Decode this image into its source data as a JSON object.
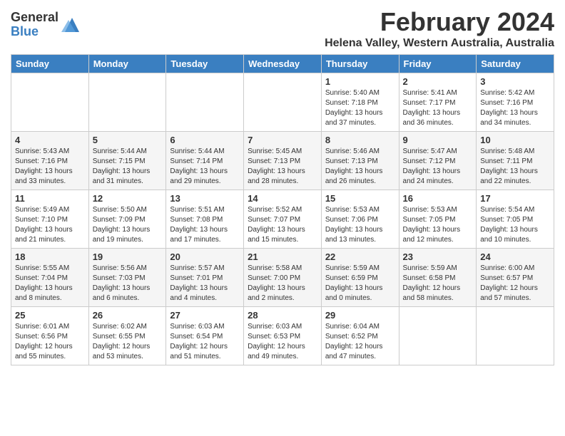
{
  "logo": {
    "general": "General",
    "blue": "Blue"
  },
  "title": "February 2024",
  "location": "Helena Valley, Western Australia, Australia",
  "headers": [
    "Sunday",
    "Monday",
    "Tuesday",
    "Wednesday",
    "Thursday",
    "Friday",
    "Saturday"
  ],
  "weeks": [
    [
      {
        "day": "",
        "info": ""
      },
      {
        "day": "",
        "info": ""
      },
      {
        "day": "",
        "info": ""
      },
      {
        "day": "",
        "info": ""
      },
      {
        "day": "1",
        "info": "Sunrise: 5:40 AM\nSunset: 7:18 PM\nDaylight: 13 hours\nand 37 minutes."
      },
      {
        "day": "2",
        "info": "Sunrise: 5:41 AM\nSunset: 7:17 PM\nDaylight: 13 hours\nand 36 minutes."
      },
      {
        "day": "3",
        "info": "Sunrise: 5:42 AM\nSunset: 7:16 PM\nDaylight: 13 hours\nand 34 minutes."
      }
    ],
    [
      {
        "day": "4",
        "info": "Sunrise: 5:43 AM\nSunset: 7:16 PM\nDaylight: 13 hours\nand 33 minutes."
      },
      {
        "day": "5",
        "info": "Sunrise: 5:44 AM\nSunset: 7:15 PM\nDaylight: 13 hours\nand 31 minutes."
      },
      {
        "day": "6",
        "info": "Sunrise: 5:44 AM\nSunset: 7:14 PM\nDaylight: 13 hours\nand 29 minutes."
      },
      {
        "day": "7",
        "info": "Sunrise: 5:45 AM\nSunset: 7:13 PM\nDaylight: 13 hours\nand 28 minutes."
      },
      {
        "day": "8",
        "info": "Sunrise: 5:46 AM\nSunset: 7:13 PM\nDaylight: 13 hours\nand 26 minutes."
      },
      {
        "day": "9",
        "info": "Sunrise: 5:47 AM\nSunset: 7:12 PM\nDaylight: 13 hours\nand 24 minutes."
      },
      {
        "day": "10",
        "info": "Sunrise: 5:48 AM\nSunset: 7:11 PM\nDaylight: 13 hours\nand 22 minutes."
      }
    ],
    [
      {
        "day": "11",
        "info": "Sunrise: 5:49 AM\nSunset: 7:10 PM\nDaylight: 13 hours\nand 21 minutes."
      },
      {
        "day": "12",
        "info": "Sunrise: 5:50 AM\nSunset: 7:09 PM\nDaylight: 13 hours\nand 19 minutes."
      },
      {
        "day": "13",
        "info": "Sunrise: 5:51 AM\nSunset: 7:08 PM\nDaylight: 13 hours\nand 17 minutes."
      },
      {
        "day": "14",
        "info": "Sunrise: 5:52 AM\nSunset: 7:07 PM\nDaylight: 13 hours\nand 15 minutes."
      },
      {
        "day": "15",
        "info": "Sunrise: 5:53 AM\nSunset: 7:06 PM\nDaylight: 13 hours\nand 13 minutes."
      },
      {
        "day": "16",
        "info": "Sunrise: 5:53 AM\nSunset: 7:05 PM\nDaylight: 13 hours\nand 12 minutes."
      },
      {
        "day": "17",
        "info": "Sunrise: 5:54 AM\nSunset: 7:05 PM\nDaylight: 13 hours\nand 10 minutes."
      }
    ],
    [
      {
        "day": "18",
        "info": "Sunrise: 5:55 AM\nSunset: 7:04 PM\nDaylight: 13 hours\nand 8 minutes."
      },
      {
        "day": "19",
        "info": "Sunrise: 5:56 AM\nSunset: 7:03 PM\nDaylight: 13 hours\nand 6 minutes."
      },
      {
        "day": "20",
        "info": "Sunrise: 5:57 AM\nSunset: 7:01 PM\nDaylight: 13 hours\nand 4 minutes."
      },
      {
        "day": "21",
        "info": "Sunrise: 5:58 AM\nSunset: 7:00 PM\nDaylight: 13 hours\nand 2 minutes."
      },
      {
        "day": "22",
        "info": "Sunrise: 5:59 AM\nSunset: 6:59 PM\nDaylight: 13 hours\nand 0 minutes."
      },
      {
        "day": "23",
        "info": "Sunrise: 5:59 AM\nSunset: 6:58 PM\nDaylight: 12 hours\nand 58 minutes."
      },
      {
        "day": "24",
        "info": "Sunrise: 6:00 AM\nSunset: 6:57 PM\nDaylight: 12 hours\nand 57 minutes."
      }
    ],
    [
      {
        "day": "25",
        "info": "Sunrise: 6:01 AM\nSunset: 6:56 PM\nDaylight: 12 hours\nand 55 minutes."
      },
      {
        "day": "26",
        "info": "Sunrise: 6:02 AM\nSunset: 6:55 PM\nDaylight: 12 hours\nand 53 minutes."
      },
      {
        "day": "27",
        "info": "Sunrise: 6:03 AM\nSunset: 6:54 PM\nDaylight: 12 hours\nand 51 minutes."
      },
      {
        "day": "28",
        "info": "Sunrise: 6:03 AM\nSunset: 6:53 PM\nDaylight: 12 hours\nand 49 minutes."
      },
      {
        "day": "29",
        "info": "Sunrise: 6:04 AM\nSunset: 6:52 PM\nDaylight: 12 hours\nand 47 minutes."
      },
      {
        "day": "",
        "info": ""
      },
      {
        "day": "",
        "info": ""
      }
    ]
  ]
}
